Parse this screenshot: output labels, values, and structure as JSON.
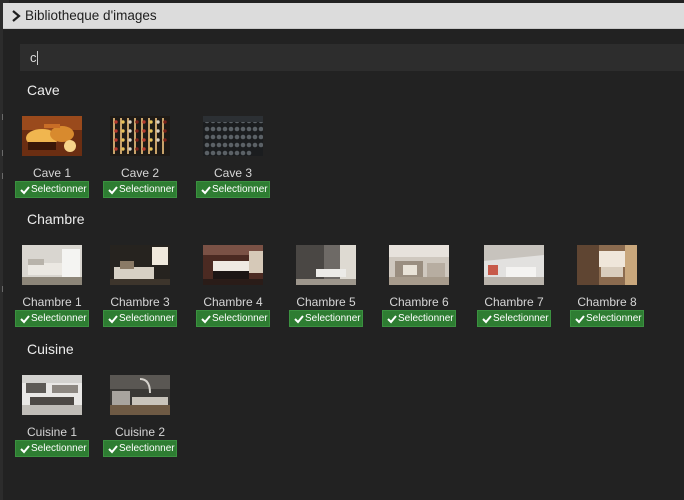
{
  "panel": {
    "title": "Bibliotheque d'images"
  },
  "search": {
    "value": "c"
  },
  "select_label": "Selectionner",
  "sections": [
    {
      "title": "Cave",
      "images": [
        {
          "name": "Cave 1",
          "icon": "cave-photo-icon"
        },
        {
          "name": "Cave 2",
          "icon": "wine-rack-photo-icon"
        },
        {
          "name": "Cave 3",
          "icon": "bottle-wall-photo-icon"
        }
      ]
    },
    {
      "title": "Chambre",
      "images": [
        {
          "name": "Chambre 1",
          "icon": "bedroom-photo-icon"
        },
        {
          "name": "Chambre 3",
          "icon": "bedroom-photo-icon"
        },
        {
          "name": "Chambre 4",
          "icon": "bedroom-photo-icon"
        },
        {
          "name": "Chambre 5",
          "icon": "bedroom-photo-icon"
        },
        {
          "name": "Chambre 6",
          "icon": "bedroom-photo-icon"
        },
        {
          "name": "Chambre 7",
          "icon": "bedroom-photo-icon"
        },
        {
          "name": "Chambre 8",
          "icon": "bedroom-photo-icon"
        }
      ]
    },
    {
      "title": "Cuisine",
      "images": [
        {
          "name": "Cuisine 1",
          "icon": "kitchen-photo-icon"
        },
        {
          "name": "Cuisine 2",
          "icon": "kitchen-photo-icon"
        }
      ]
    }
  ],
  "colors": {
    "accent": "#2e7d32",
    "background": "#222222",
    "titlebar": "#dcdcdc"
  }
}
